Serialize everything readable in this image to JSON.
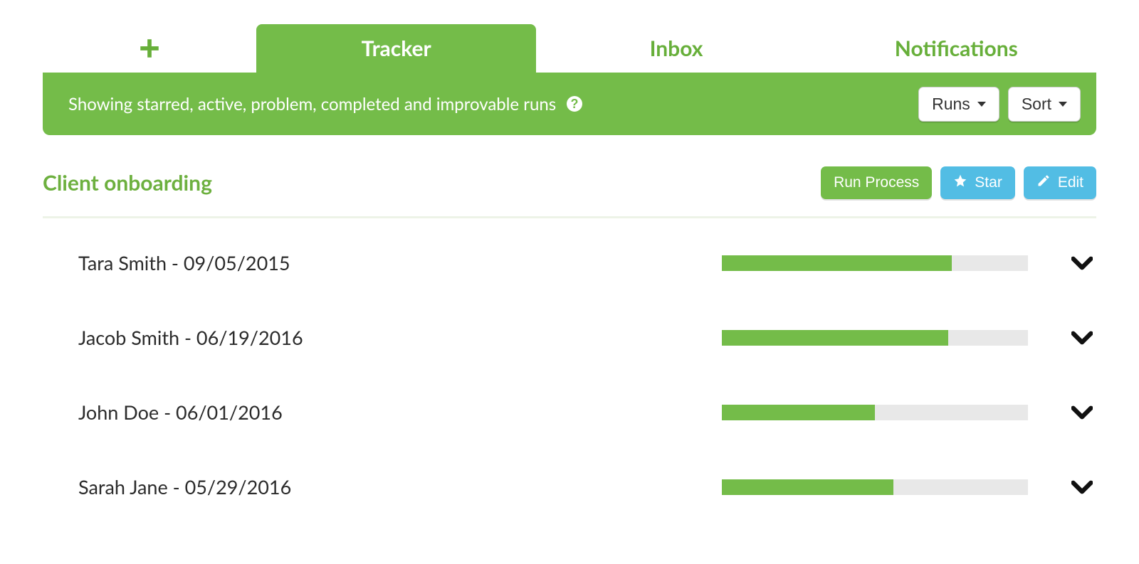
{
  "tabs": {
    "tracker": "Tracker",
    "inbox": "Inbox",
    "notifications": "Notifications"
  },
  "filter_bar": {
    "text": "Showing starred, active, problem, completed and improvable runs",
    "runs_label": "Runs",
    "sort_label": "Sort"
  },
  "header": {
    "title": "Client onboarding",
    "run_process": "Run Process",
    "star": "Star",
    "edit": "Edit"
  },
  "runs": [
    {
      "label": "Tara Smith - 09/05/2015",
      "progress": 75
    },
    {
      "label": "Jacob Smith - 06/19/2016",
      "progress": 74
    },
    {
      "label": "John Doe - 06/01/2016",
      "progress": 50
    },
    {
      "label": "Sarah Jane - 05/29/2016",
      "progress": 56
    }
  ]
}
